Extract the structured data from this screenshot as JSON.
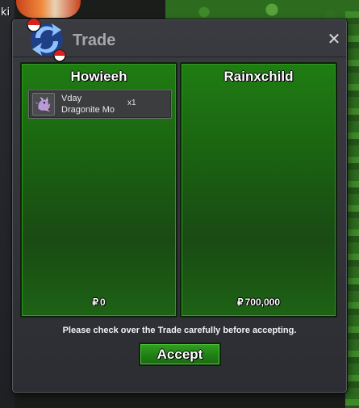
{
  "background": {
    "player_name_fragment": "ki"
  },
  "window": {
    "title": "Trade",
    "close_symbol": "✕",
    "icon": "trade-arrows-icon"
  },
  "trader_left": {
    "name": "Howieeh",
    "currency_symbol": "₽",
    "money": "0",
    "items": [
      {
        "name_line1": "Vday",
        "name_line2": "Dragonite Mo",
        "quantity": "x1",
        "icon": "dragonite-item-icon"
      }
    ]
  },
  "trader_right": {
    "name": "Rainxchild",
    "currency_symbol": "₽",
    "money": "700,000"
  },
  "notice": "Please check over the Trade carefully before accepting.",
  "accept_label": "Accept",
  "colors": {
    "panel_green": "#1f7d12",
    "accept_green": "#2fa21f",
    "window_bg": "#34353b"
  }
}
